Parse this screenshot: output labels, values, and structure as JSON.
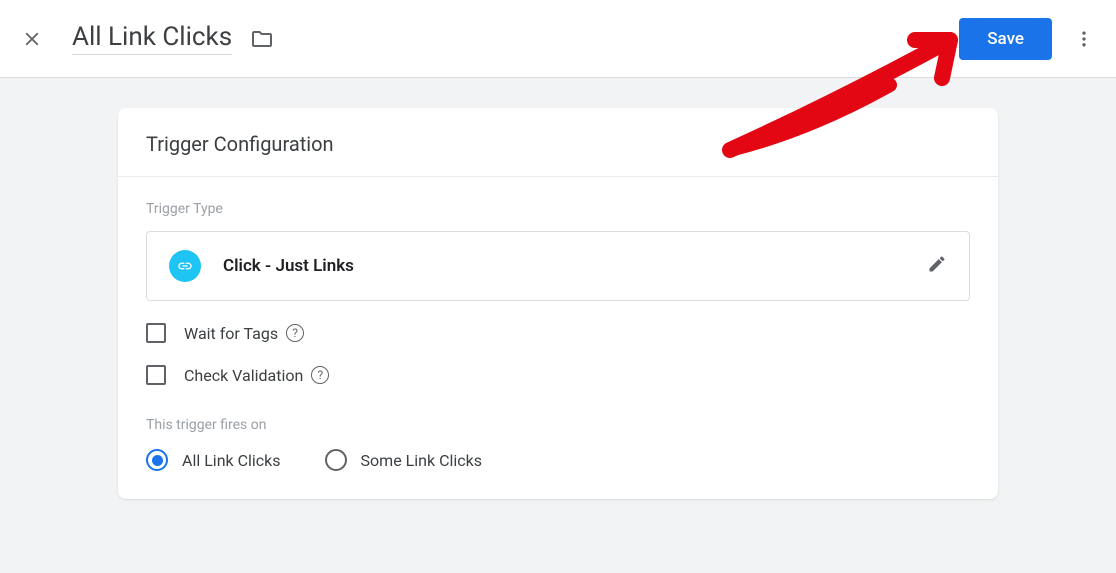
{
  "header": {
    "title": "All Link Clicks",
    "save_label": "Save"
  },
  "card": {
    "title": "Trigger Configuration",
    "trigger_type_label": "Trigger Type",
    "trigger_type_value": "Click - Just Links",
    "checkbox_wait": "Wait for Tags",
    "checkbox_validation": "Check Validation",
    "fires_on_label": "This trigger fires on",
    "radio_all": "All Link Clicks",
    "radio_some": "Some Link Clicks"
  }
}
